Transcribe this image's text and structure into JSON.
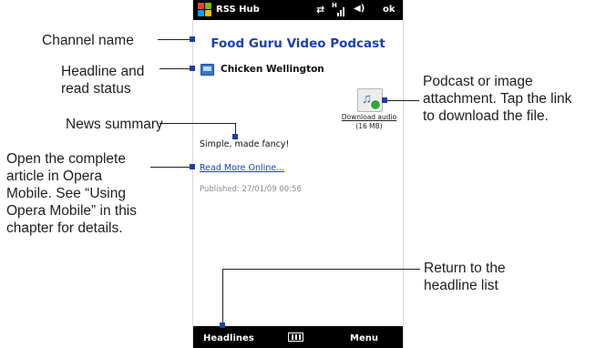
{
  "statusbar": {
    "app_title": "RSS Hub",
    "ok_label": "ok",
    "signal_label": "H"
  },
  "screen": {
    "channel_name": "Food Guru Video Podcast",
    "headline": "Chicken Wellington",
    "attachment": {
      "icon": "audio-download-icon",
      "link_label": "Download audio",
      "size": "(16 MB)"
    },
    "summary": "Simple, made fancy!",
    "read_more": "Read More Online...",
    "published": "Published: 27/01/09 00:56"
  },
  "softkeys": {
    "left": "Headlines",
    "right": "Menu",
    "center_icon": "keyboard-icon"
  },
  "callouts": {
    "channel_name": "Channel name",
    "headline_line1": "Headline and",
    "headline_line2": "read status",
    "summary": "News summary",
    "open_line1": "Open the complete",
    "open_line2": "article in Opera",
    "open_line3": "Mobile. See “Using",
    "open_line4": "Opera Mobile” in this",
    "open_line5": "chapter for details.",
    "attach_line1": "Podcast or image",
    "attach_line2": "attachment. Tap the link",
    "attach_line3": "to download the file.",
    "return_line1": "Return to the",
    "return_line2": "headline list"
  },
  "colors": {
    "callout_marker": "#1f3fa6",
    "channel_title": "#1a3fb0",
    "link": "#1a3fd0"
  }
}
